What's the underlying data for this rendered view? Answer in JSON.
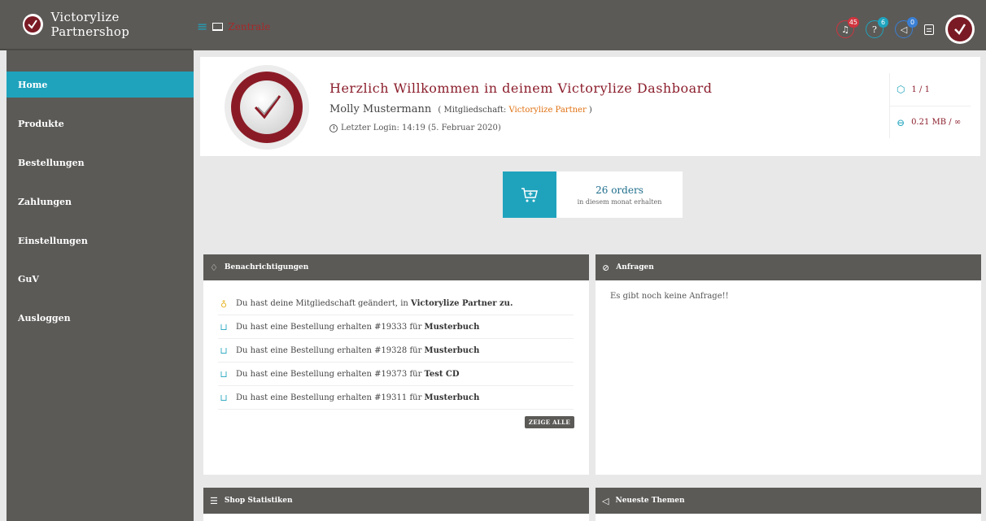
{
  "topbar": {
    "brand_name": "Victorylize Partnershop",
    "breadcrumb": "Zentrale",
    "notifications_badge": "45",
    "help_badge": "6",
    "announcements_badge": "0"
  },
  "sidebar": {
    "items": [
      {
        "label": "Home",
        "active": true
      },
      {
        "label": "Produkte"
      },
      {
        "label": "Bestellungen"
      },
      {
        "label": "Zahlungen"
      },
      {
        "label": "Einstellungen"
      },
      {
        "label": "GuV"
      },
      {
        "label": "Ausloggen"
      }
    ]
  },
  "welcome": {
    "title": "Herzlich Willkommen in deinem Victorylize Dashboard",
    "user_name": "Molly Mustermann",
    "membership_prefix": "( Mitgliedschaft:",
    "membership_name": "Victorylize Partner",
    "membership_suffix": ")",
    "last_login": "Letzter Login: 14:19 (5. Februar 2020)",
    "products_stat": "1 / 1",
    "storage_stat": "0.21 MB / ∞"
  },
  "orders": {
    "count_text": "26 orders",
    "subtitle": "in diesem monat erhalten"
  },
  "notifications": {
    "title": "Benachrichtigungen",
    "items": [
      {
        "icon": "user-icon",
        "text": "Du hast deine Mitgliedschaft geändert, in ",
        "bold": "Victorylize Partner zu."
      },
      {
        "icon": "cart-icon",
        "text": "Du hast eine Bestellung erhalten #19333 für ",
        "bold": "Musterbuch"
      },
      {
        "icon": "cart-icon",
        "text": "Du hast eine Bestellung erhalten #19328 für ",
        "bold": "Musterbuch"
      },
      {
        "icon": "cart-icon",
        "text": "Du hast eine Bestellung erhalten #19373 für ",
        "bold": "Test CD"
      },
      {
        "icon": "cart-icon",
        "text": "Du hast eine Bestellung erhalten #19311 für ",
        "bold": "Musterbuch"
      }
    ],
    "show_all_label": "ZEIGE ALLE"
  },
  "requests": {
    "title": "Anfragen",
    "empty_text": "Es gibt noch keine Anfrage!!"
  },
  "shop_stats": {
    "title": "Shop Statistiken"
  },
  "latest_topics": {
    "title": "Neueste Themen"
  },
  "colors": {
    "accent": "#1fa3bd",
    "dark": "#5b5a57",
    "brand_red": "#8b1e2c"
  }
}
